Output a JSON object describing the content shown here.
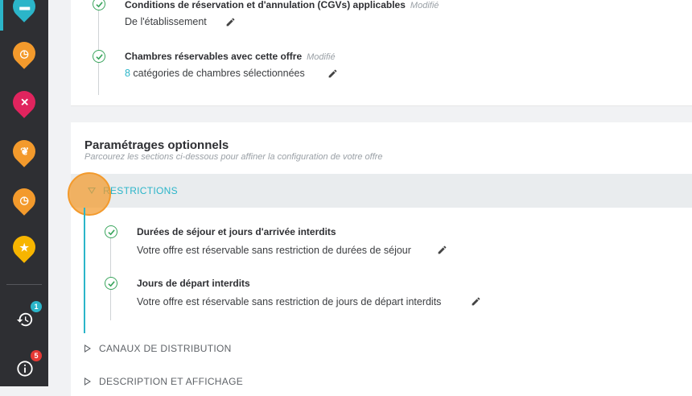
{
  "sidebar": {
    "items": [
      {
        "icon": "hotel-icon",
        "color": "#2bb5c9",
        "active": true
      },
      {
        "icon": "clock-icon",
        "color": "#f39a2c"
      },
      {
        "icon": "restaurant-icon",
        "color": "#e0245e"
      },
      {
        "icon": "spa-icon",
        "color": "#f39a2c"
      },
      {
        "icon": "clock-icon",
        "color": "#f39a2c"
      },
      {
        "icon": "star-icon",
        "color": "#f7b500"
      }
    ],
    "history_badge": "1",
    "info_badge": "5"
  },
  "required": {
    "items": [
      {
        "title": "Conditions de réservation et d'annulation (CGVs) applicables",
        "modified": "Modifié",
        "desc": "De l'établissement"
      },
      {
        "title": "Chambres réservables avec cette offre",
        "modified": "Modifié",
        "count": "8",
        "desc": " catégories de chambres sélectionnées"
      }
    ]
  },
  "optional": {
    "title": "Paramétrages optionnels",
    "subtitle": "Parcourez les sections ci-dessous pour affiner la configuration de votre offre",
    "open_section": {
      "label": "RESTRICTIONS",
      "items": [
        {
          "title": "Durées de séjour et jours d'arrivée interdits",
          "desc": "Votre offre est réservable sans restriction de durées de séjour"
        },
        {
          "title": "Jours de départ interdits",
          "desc": "Votre offre est réservable sans restriction de jours de départ interdits"
        }
      ]
    },
    "closed_sections": [
      "CANAUX DE DISTRIBUTION",
      "DESCRIPTION ET AFFICHAGE"
    ]
  },
  "colors": {
    "accent": "#2bb5c9",
    "success": "#3aa55d",
    "highlight": "#f39a2c"
  }
}
